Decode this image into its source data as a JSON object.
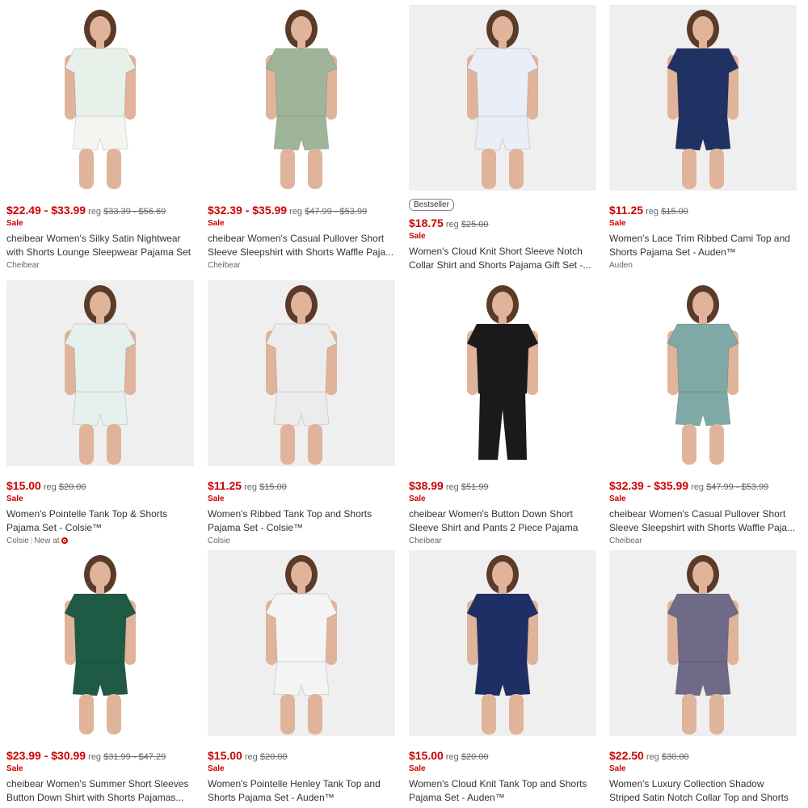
{
  "accent": "#cc0000",
  "products": [
    {
      "badge": "",
      "price": "$22.49 - $33.99",
      "reg_label": "reg",
      "reg_price": "$33.39 - $56.69",
      "sale": "Sale",
      "title": "cheibear Women's Silky Satin Nightwear with Shorts Lounge Sleepwear Pajama Set",
      "brand": "Cheibear",
      "new_at": "",
      "image": "floral satin pajama set",
      "top_color": "#e8f0ea",
      "bottom_color": "#f4f4f0",
      "bg": "white",
      "pants": "shorts"
    },
    {
      "badge": "",
      "price": "$32.39 - $35.99",
      "reg_label": "reg",
      "reg_price": "$47.99 - $53.99",
      "sale": "Sale",
      "title": "cheibear Women's Casual Pullover Short Sleeve Sleepshirt with Shorts Waffle Paja...",
      "brand": "Cheibear",
      "new_at": "",
      "image": "sage green waffle set",
      "top_color": "#9fb59a",
      "bottom_color": "#9fb59a",
      "bg": "white",
      "pants": "shorts"
    },
    {
      "badge": "Bestseller",
      "price": "$18.75",
      "reg_label": "reg",
      "reg_price": "$25.00",
      "sale": "Sale",
      "title": "Women's Cloud Knit Short Sleeve Notch Collar Shirt and Shorts Pajama Gift Set -...",
      "brand": "",
      "new_at": "",
      "image": "blue white print notch collar set",
      "top_color": "#e9eef8",
      "bottom_color": "#e9eef8",
      "bg": "grey",
      "pants": "shorts"
    },
    {
      "badge": "",
      "price": "$11.25",
      "reg_label": "reg",
      "reg_price": "$15.00",
      "sale": "Sale",
      "title": "Women's Lace Trim Ribbed Cami Top and Shorts Pajama Set - Auden™",
      "brand": "Auden",
      "new_at": "",
      "image": "navy lace cami set",
      "top_color": "#1f3263",
      "bottom_color": "#1f3263",
      "bg": "grey",
      "pants": "shorts"
    },
    {
      "badge": "",
      "price": "$15.00",
      "reg_label": "reg",
      "reg_price": "$20.00",
      "sale": "Sale",
      "title": "Women's Pointelle Tank Top & Shorts Pajama Set - Colsie™",
      "brand": "Colsie",
      "new_at": "New at",
      "image": "pointelle tank and shorts",
      "top_color": "#e6f1ee",
      "bottom_color": "#e6f1ee",
      "bg": "grey",
      "pants": "shorts"
    },
    {
      "badge": "",
      "price": "$11.25",
      "reg_label": "reg",
      "reg_price": "$15.00",
      "sale": "Sale",
      "title": "Women's Ribbed Tank Top and Shorts Pajama Set - Colsie™",
      "brand": "Colsie",
      "new_at": "",
      "image": "white ribbed tank set",
      "top_color": "#ececec",
      "bottom_color": "#ececec",
      "bg": "grey",
      "pants": "shorts"
    },
    {
      "badge": "",
      "price": "$38.99",
      "reg_label": "reg",
      "reg_price": "$51.99",
      "sale": "Sale",
      "title": "cheibear Women's Button Down Short Sleeve Shirt and Pants 2 Piece Pajama Se...",
      "brand": "Cheibear",
      "new_at": "",
      "image": "black button down pants set",
      "top_color": "#1a1a1a",
      "bottom_color": "#1a1a1a",
      "bg": "white",
      "pants": "pants"
    },
    {
      "badge": "",
      "price": "$32.39 - $35.99",
      "reg_label": "reg",
      "reg_price": "$47.99 - $53.99",
      "sale": "Sale",
      "title": "cheibear Women's Casual Pullover Short Sleeve Sleepshirt with Shorts Waffle Paja...",
      "brand": "Cheibear",
      "new_at": "",
      "image": "teal waffle set",
      "top_color": "#7fa9a6",
      "bottom_color": "#7fa9a6",
      "bg": "white",
      "pants": "shorts"
    },
    {
      "badge": "",
      "price": "$23.99 - $30.99",
      "reg_label": "reg",
      "reg_price": "$31.99 - $47.29",
      "sale": "Sale",
      "title": "cheibear Women's Summer Short Sleeves Button Down Shirt with Shorts Pajamas...",
      "brand": "",
      "new_at": "",
      "image": "green floral satin set",
      "top_color": "#1f5a45",
      "bottom_color": "#1f5a45",
      "bg": "white",
      "pants": "shorts"
    },
    {
      "badge": "",
      "price": "$15.00",
      "reg_label": "reg",
      "reg_price": "$20.00",
      "sale": "Sale",
      "title": "Women's Pointelle Henley Tank Top and Shorts Pajama Set - Auden™",
      "brand": "",
      "new_at": "",
      "image": "white henley tank set",
      "top_color": "#f4f4f4",
      "bottom_color": "#f4f4f4",
      "bg": "grey",
      "pants": "shorts"
    },
    {
      "badge": "",
      "price": "$15.00",
      "reg_label": "reg",
      "reg_price": "$20.00",
      "sale": "Sale",
      "title": "Women's Cloud Knit Tank Top and Shorts Pajama Set - Auden™",
      "brand": "",
      "new_at": "",
      "image": "navy cami and shorts",
      "top_color": "#1e2f66",
      "bottom_color": "#1e2f66",
      "bg": "grey",
      "pants": "shorts"
    },
    {
      "badge": "",
      "price": "$22.50",
      "reg_label": "reg",
      "reg_price": "$30.00",
      "sale": "Sale",
      "title": "Women's Luxury Collection Shadow Striped Satin Notch Collar Top and Shorts Pajama...",
      "brand": "",
      "new_at": "",
      "image": "purple striped satin set",
      "top_color": "#6f6a88",
      "bottom_color": "#6f6a88",
      "bg": "grey",
      "pants": "shorts"
    }
  ]
}
